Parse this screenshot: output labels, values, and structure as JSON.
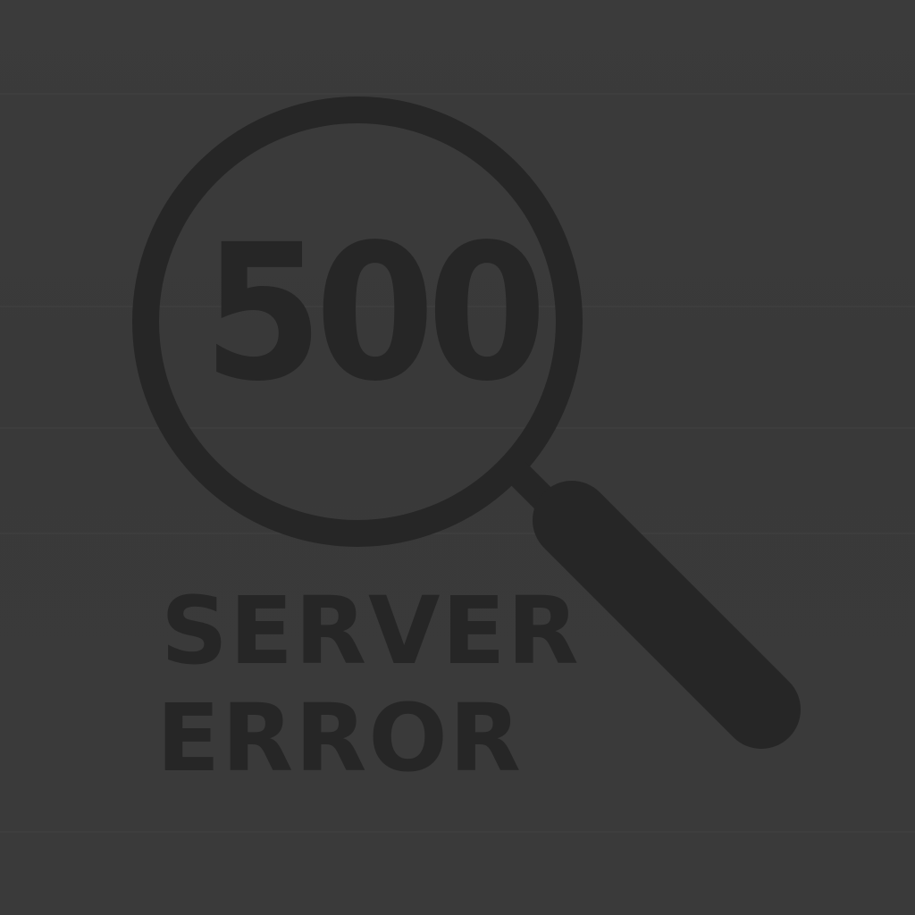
{
  "error": {
    "code": "500",
    "title_line1": "SERVER",
    "title_line2": "ERROR"
  },
  "icons": {
    "main": "magnifying-glass-icon"
  },
  "colors": {
    "background": "#3a3a3a",
    "foreground": "#262626"
  }
}
